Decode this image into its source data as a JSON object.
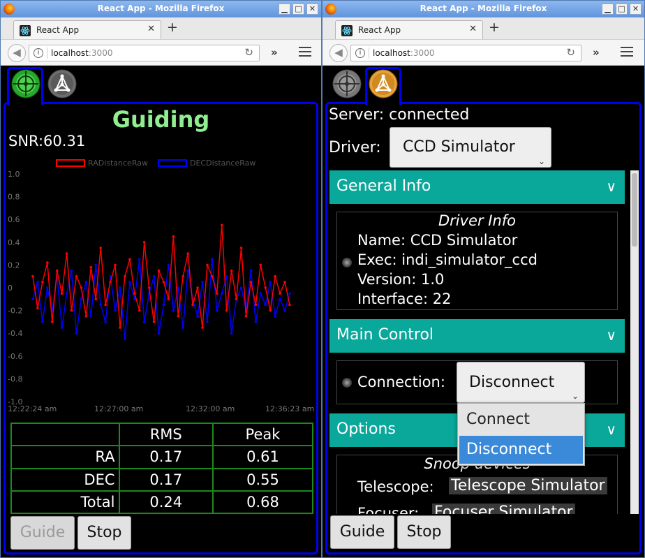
{
  "left": {
    "window_title": "React App - Mozilla Firefox",
    "tab_title": "React App",
    "url_host": "localhost",
    "url_port": ":3000",
    "heading": "Guiding",
    "snr": "SNR:60.31",
    "chart_data": {
      "type": "line",
      "title": "",
      "series": [
        {
          "name": "RADistanceRaw",
          "color": "#ff0000",
          "values": [
            0.1,
            -0.18,
            0.05,
            0.22,
            -0.3,
            0.15,
            -0.05,
            0.3,
            -0.2,
            0.1,
            0.0,
            -0.25,
            0.18,
            -0.1,
            0.35,
            -0.15,
            0.05,
            0.2,
            -0.35,
            0.1,
            0.25,
            -0.05,
            -0.2,
            0.4,
            0.0,
            -0.3,
            0.15,
            0.05,
            -0.1,
            0.45,
            -0.25,
            0.1,
            0.3,
            -0.15,
            0.0,
            -0.35,
            0.2,
            0.1,
            -0.05,
            0.55,
            -0.2,
            0.15,
            -0.1,
            0.35,
            -0.25,
            0.05,
            -0.15,
            0.2,
            0.0,
            -0.2,
            0.1,
            -0.05,
            0.05,
            -0.15
          ]
        },
        {
          "name": "DECDistanceRaw",
          "color": "#0000ff",
          "values": [
            -0.1,
            0.05,
            -0.3,
            0.0,
            -0.2,
            0.1,
            -0.35,
            -0.05,
            0.15,
            -0.4,
            -0.1,
            0.05,
            -0.25,
            0.2,
            -0.15,
            -0.3,
            0.1,
            -0.2,
            0.0,
            -0.45,
            0.05,
            -0.1,
            0.25,
            -0.3,
            -0.05,
            0.1,
            -0.4,
            -0.15,
            0.2,
            -0.2,
            0.0,
            -0.35,
            0.15,
            -0.1,
            -0.25,
            0.05,
            -0.3,
            0.25,
            -0.2,
            -0.05,
            0.1,
            -0.4,
            -0.1,
            0.0,
            -0.2,
            0.15,
            -0.3,
            -0.05,
            -0.15,
            0.05,
            -0.25,
            -0.1,
            -0.2,
            -0.05
          ]
        }
      ],
      "y_ticks": [
        "1.0",
        "0.8",
        "0.6",
        "0.4",
        "0.2",
        "0",
        "-0.2",
        "-0.4",
        "-0.6",
        "-0.8",
        "-1.0"
      ],
      "ylim": [
        -1.0,
        1.0
      ],
      "x_ticks": [
        "12:22:24 am",
        "12:27:00 am",
        "12:32:00 am",
        "12:36:23 am"
      ],
      "grid": false,
      "legend": "top"
    },
    "stats": {
      "headers": [
        "",
        "RMS",
        "Peak"
      ],
      "rows": [
        {
          "label": "RA",
          "rms": "0.17",
          "peak": "0.61"
        },
        {
          "label": "DEC",
          "rms": "0.17",
          "peak": "0.55"
        },
        {
          "label": "Total",
          "rms": "0.24",
          "peak": "0.68"
        }
      ]
    },
    "guide_label": "Guide",
    "stop_label": "Stop"
  },
  "right": {
    "window_title": "React App - Mozilla Firefox",
    "tab_title": "React App",
    "url_host": "localhost",
    "url_port": ":3000",
    "server_status": "Server: connected",
    "driver_label": "Driver:",
    "driver_value": "CCD Simulator",
    "general_info": {
      "header": "General Info",
      "box_title": "Driver Info",
      "lines": [
        "Name: CCD Simulator",
        "Exec: indi_simulator_ccd",
        "Version: 1.0",
        "Interface: 22"
      ]
    },
    "main_control": {
      "header": "Main Control",
      "connection_label": "Connection:",
      "connection_value": "Disconnect",
      "options": [
        "Connect",
        "Disconnect"
      ]
    },
    "options": {
      "header": "Options",
      "box_title": "Snoop devices",
      "telescope_label": "Telescope:",
      "telescope_value": "Telescope Simulator",
      "focuser_label": "Focuser:",
      "focuser_value": "Focuser Simulator"
    },
    "chevron": "∨",
    "guide_label": "Guide",
    "stop_label": "Stop"
  },
  "window_buttons": [
    "▁",
    "□",
    "✕"
  ],
  "colors": {
    "accent": "#0000ee",
    "teal": "#0aa79b",
    "guiding_text": "#90ee90",
    "table_border": "#1b8a1b"
  }
}
